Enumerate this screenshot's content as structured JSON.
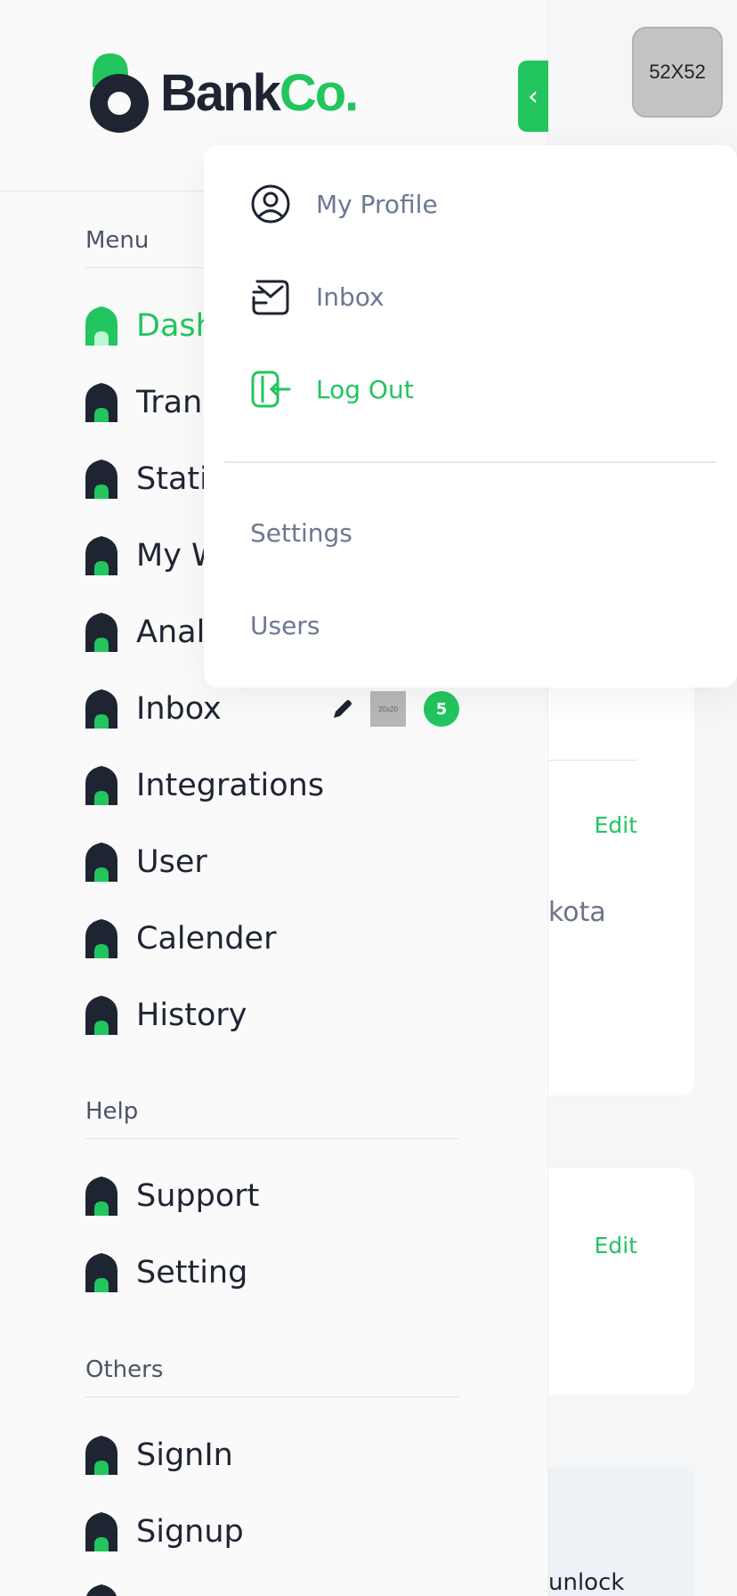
{
  "app": {
    "logo_primary": "Bank",
    "logo_accent": "Co.",
    "avatar_label": "52X52"
  },
  "colors": {
    "accent": "#22c55e",
    "dark": "#1f2433",
    "muted": "#6b7892"
  },
  "sidebar": {
    "sections": [
      {
        "title": "Menu",
        "items": [
          {
            "label": "Dashboard",
            "icon": "home-icon",
            "active": true
          },
          {
            "label": "Transaction",
            "icon": "home-icon"
          },
          {
            "label": "Statistics",
            "icon": "home-icon"
          },
          {
            "label": "My Wallet",
            "icon": "home-icon"
          },
          {
            "label": "Analytics",
            "icon": "home-icon"
          },
          {
            "label": "Inbox",
            "icon": "home-icon",
            "badge": "5",
            "thumb": "20x20"
          },
          {
            "label": "Integrations",
            "icon": "home-icon"
          },
          {
            "label": "User",
            "icon": "home-icon"
          },
          {
            "label": "Calender",
            "icon": "home-icon"
          },
          {
            "label": "History",
            "icon": "home-icon"
          }
        ]
      },
      {
        "title": "Help",
        "items": [
          {
            "label": "Support",
            "icon": "home-icon"
          },
          {
            "label": "Setting",
            "icon": "home-icon"
          }
        ]
      },
      {
        "title": "Others",
        "items": [
          {
            "label": "SignIn",
            "icon": "home-icon"
          },
          {
            "label": "Signup",
            "icon": "home-icon"
          }
        ]
      }
    ]
  },
  "dropdown": {
    "items": [
      {
        "label": "My Profile",
        "icon": "user-circle-icon"
      },
      {
        "label": "Inbox",
        "icon": "mail-icon"
      },
      {
        "label": "Log Out",
        "icon": "logout-icon"
      }
    ],
    "links": [
      "Settings",
      "Users"
    ]
  },
  "main": {
    "edit_label_1": "Edit",
    "edit_label_2": "Edit",
    "partial_text_1": "kota",
    "partial_text_2": "unlock"
  }
}
